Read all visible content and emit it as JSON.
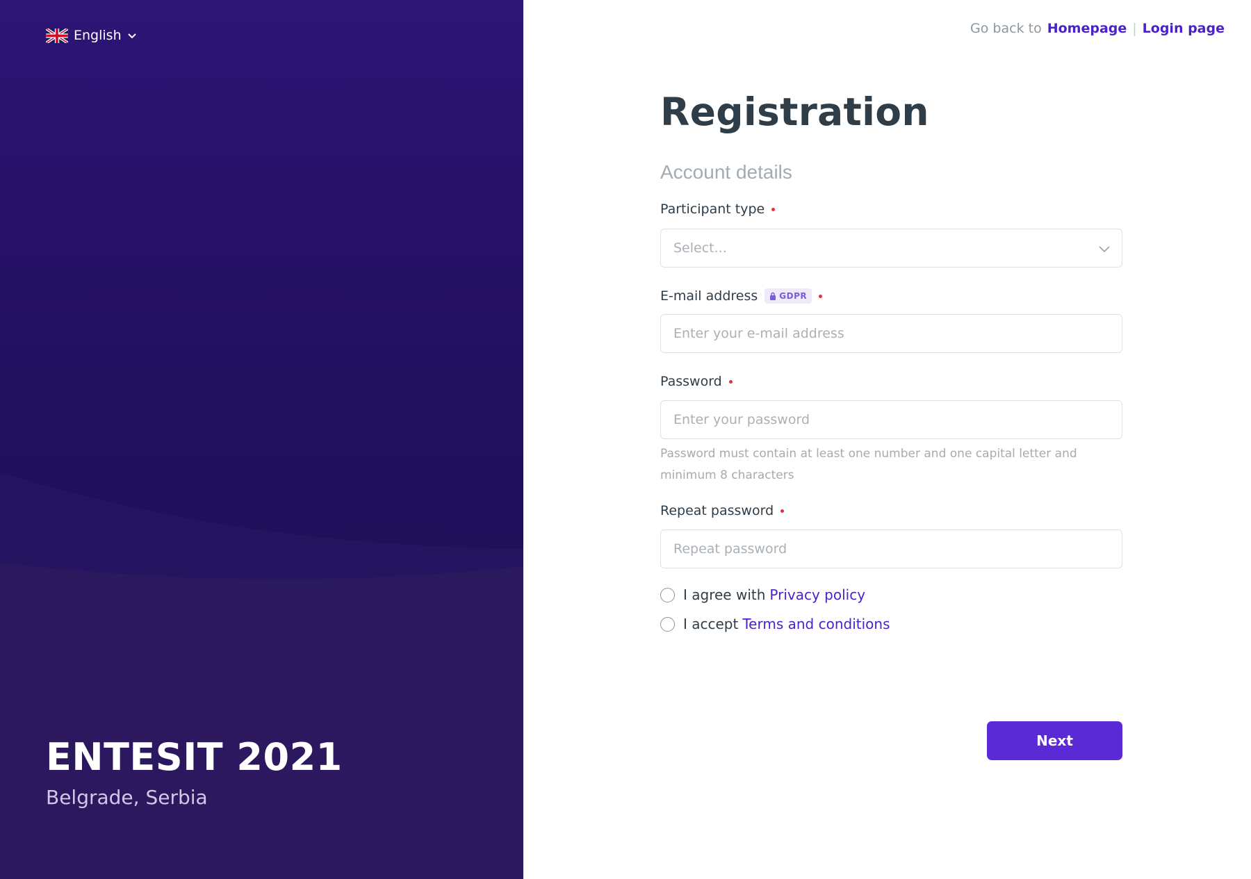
{
  "language": {
    "label": "English",
    "flag_icon": "uk-flag-icon"
  },
  "event": {
    "title": "ENTESIT 2021",
    "location": "Belgrade, Serbia"
  },
  "top_links": {
    "prefix": "Go back to",
    "homepage": "Homepage",
    "separator": "|",
    "login": "Login page"
  },
  "form": {
    "title": "Registration",
    "section": "Account details",
    "participant_type": {
      "label": "Participant type",
      "placeholder": "Select..."
    },
    "email": {
      "label": "E-mail address",
      "badge": "GDPR",
      "placeholder": "Enter your e-mail address"
    },
    "password": {
      "label": "Password",
      "placeholder": "Enter your password",
      "hint": "Password must contain at least one number and one capital letter and minimum 8 characters"
    },
    "repeat_password": {
      "label": "Repeat password",
      "placeholder": "Repeat password"
    },
    "privacy": {
      "prefix": "I agree with",
      "link": "Privacy policy"
    },
    "terms": {
      "prefix": "I accept",
      "link": "Terms and conditions"
    },
    "next_label": "Next"
  },
  "colors": {
    "accent": "#5a2ad6",
    "link": "#4a22c7",
    "panel": "#21105e",
    "required": "#e5303a"
  }
}
